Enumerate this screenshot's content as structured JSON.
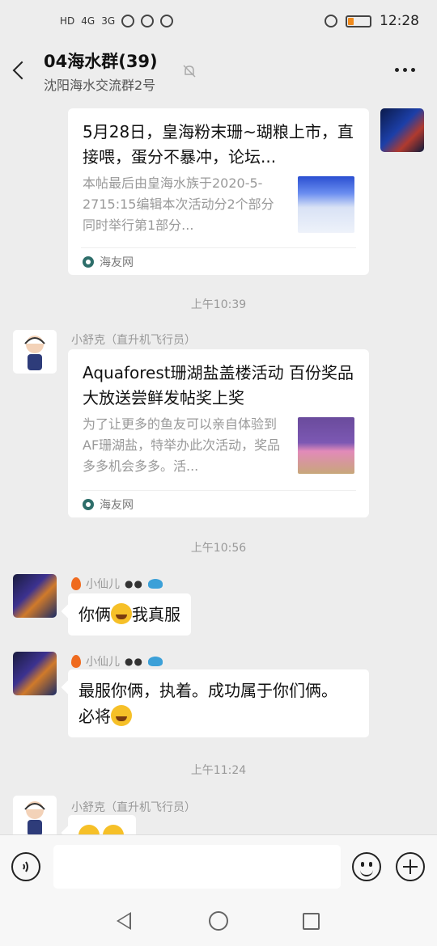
{
  "status_bar": {
    "left_icons": [
      "HD",
      "4G",
      "3G"
    ],
    "time": "12:28",
    "battery_level": 0.25,
    "battery_color": "#f08a1c"
  },
  "header": {
    "title": "04海水群(39)",
    "subtitle": "沈阳海水交流群2号"
  },
  "messages": {
    "card1": {
      "title": "5月28日，皇海粉末珊~瑚粮上市，直接喂，蛋分不暴冲，论坛...",
      "description": "本帖最后由皇海水族于2020-5-2715:15编辑本次活动分2个部分同时举行第1部分...",
      "source": "海友网"
    },
    "time1": "上午10:39",
    "msg2": {
      "sender": "小舒克（直升机飞行员）",
      "card": {
        "title": "Aquaforest珊湖盐盖楼活动 百份奖品大放送尝鲜发帖奖上奖",
        "description": "为了让更多的鱼友可以亲自体验到AF珊湖盐，特举办此次活动，奖品多多机会多多。活...",
        "source": "海友网"
      }
    },
    "time2": "上午10:56",
    "msg3": {
      "sender": "小仙儿",
      "text_before": "你俩",
      "text_after": "我真服"
    },
    "msg4": {
      "sender": "小仙儿",
      "line1": "最服你俩，执着。成功属于你们俩。",
      "line2": "必将"
    },
    "time3": "上午11:24",
    "msg5": {
      "sender": "小舒克（直升机飞行员）"
    }
  },
  "input_bar": {
    "value": "",
    "placeholder": ""
  },
  "colors": {
    "chat_bg": "#ededed",
    "bubble_bg": "#ffffff",
    "meta_text": "#999999"
  }
}
